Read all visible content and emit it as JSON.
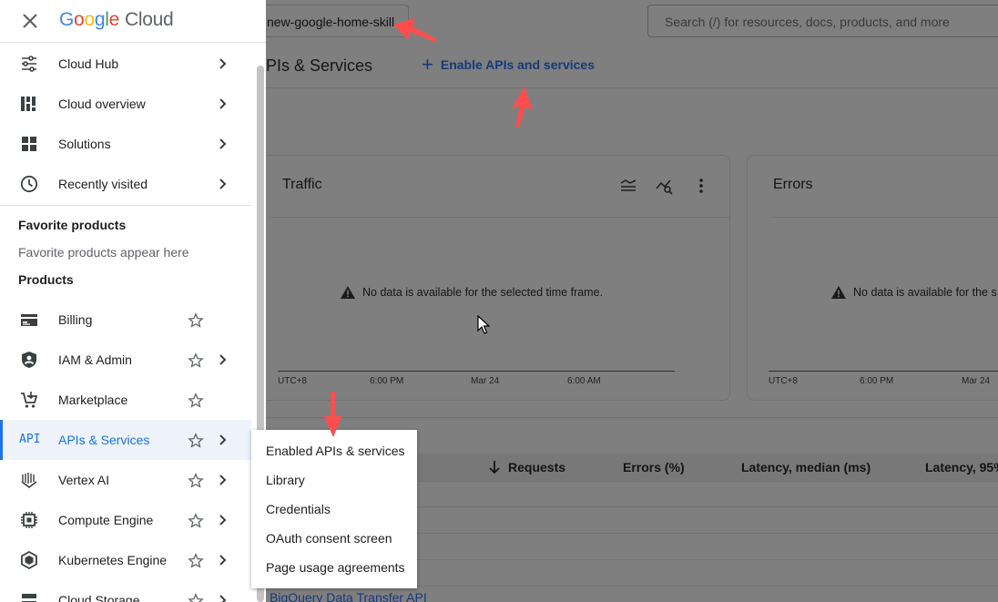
{
  "header": {
    "project_name": "new-google-home-skill",
    "search_placeholder": "Search (/) for resources, docs, products, and more"
  },
  "logo": {
    "google": [
      "G",
      "o",
      "o",
      "g",
      "l",
      "e"
    ],
    "product": "Cloud"
  },
  "page": {
    "title": "PIs & Services",
    "enable_button": "Enable APIs and services"
  },
  "cards": {
    "traffic": {
      "title": "Traffic",
      "no_data": "No data is available for the selected time frame.",
      "ticks": [
        "UTC+8",
        "6:00 PM",
        "Mar 24",
        "6:00 AM"
      ]
    },
    "errors": {
      "title": "Errors",
      "no_data": "No data is available for the s",
      "ticks": [
        "UTC+8",
        "6:00 PM",
        "Mar 24"
      ]
    }
  },
  "table": {
    "columns": [
      "Requests",
      "Errors (%)",
      "Latency, median (ms)",
      "Latency, 95%"
    ],
    "partial_row": "BigQuery Data Transfer API"
  },
  "sidebar": {
    "top_items": [
      {
        "label": "Cloud Hub",
        "icon": "tune-icon"
      },
      {
        "label": "Cloud overview",
        "icon": "dashboard-icon"
      },
      {
        "label": "Solutions",
        "icon": "grid-icon"
      },
      {
        "label": "Recently visited",
        "icon": "clock-icon"
      }
    ],
    "favorites_heading": "Favorite products",
    "favorites_hint": "Favorite products appear here",
    "products_heading": "Products",
    "products": [
      {
        "label": "Billing",
        "icon": "billing-icon",
        "has_submenu": false
      },
      {
        "label": "IAM & Admin",
        "icon": "shield-icon",
        "has_submenu": true
      },
      {
        "label": "Marketplace",
        "icon": "cart-icon",
        "has_submenu": false
      },
      {
        "label": "APIs & Services",
        "icon": "api-icon",
        "has_submenu": true,
        "active": true
      },
      {
        "label": "Vertex AI",
        "icon": "vertex-icon",
        "has_submenu": true
      },
      {
        "label": "Compute Engine",
        "icon": "chip-icon",
        "has_submenu": true
      },
      {
        "label": "Kubernetes Engine",
        "icon": "kubernetes-icon",
        "has_submenu": true
      },
      {
        "label": "Cloud Storage",
        "icon": "storage-icon",
        "has_submenu": true
      }
    ],
    "api_icon_text": "API"
  },
  "flyout": {
    "items": [
      "Enabled APIs & services",
      "Library",
      "Credentials",
      "OAuth consent screen",
      "Page usage agreements"
    ]
  },
  "colors": {
    "accent": "#1a73e8",
    "annotation_arrow": "#ff4d4d",
    "overlay": "#7f7f7f"
  }
}
